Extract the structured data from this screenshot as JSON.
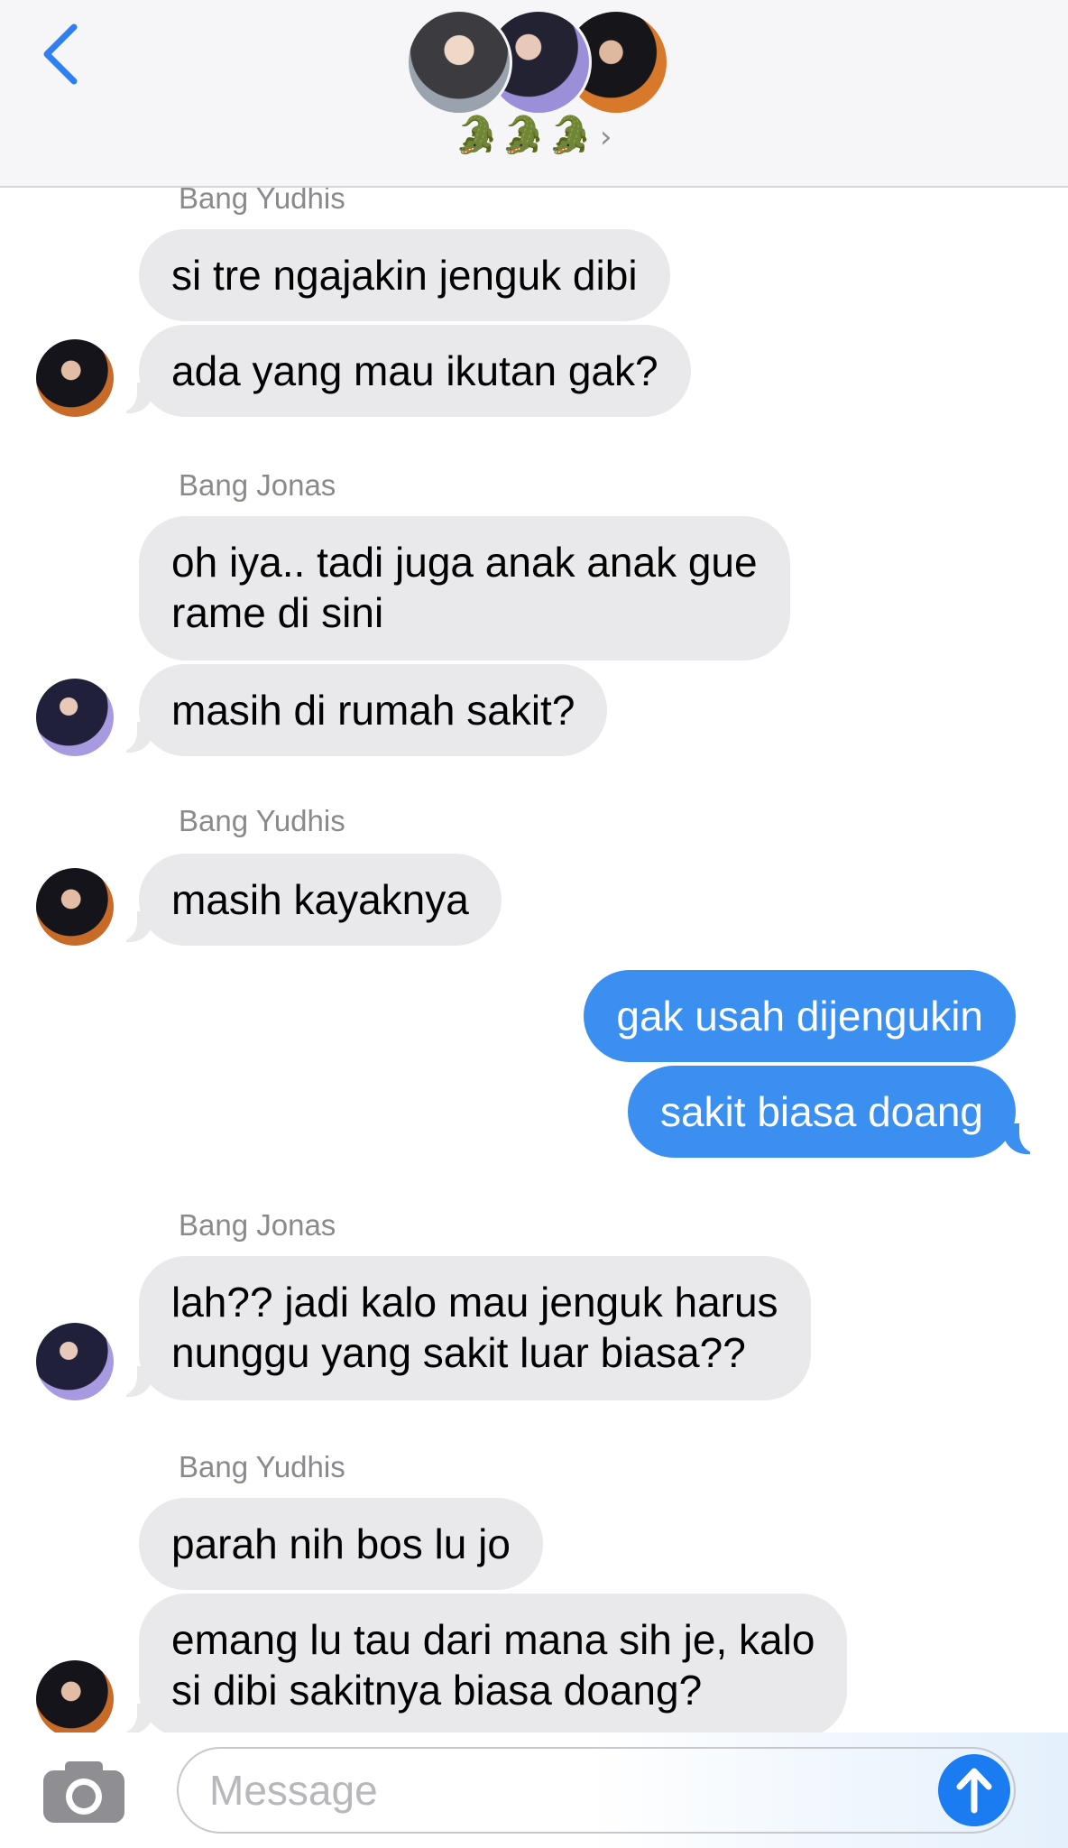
{
  "header": {
    "group_name": "🐊🐊🐊",
    "chevron": "›",
    "participants": [
      "avatar-1",
      "avatar-2",
      "avatar-3"
    ]
  },
  "messages": {
    "s1": "Bang Yudhis",
    "m1": "si tre ngajakin jenguk dibi",
    "m2": "ada yang mau ikutan gak?",
    "s2": "Bang Jonas",
    "m3": "oh iya.. tadi juga anak anak gue\nrame di sini",
    "m4": "masih di rumah sakit?",
    "s3": "Bang Yudhis",
    "m5": "masih kayaknya",
    "o1": "gak usah dijengukin",
    "o2": "sakit biasa doang",
    "s4": "Bang Jonas",
    "m6": "lah?? jadi kalo mau jenguk harus\nnunggu yang sakit luar biasa??",
    "s5": "Bang Yudhis",
    "m7": "parah nih bos lu jo",
    "m8": "emang lu tau dari mana sih je, kalo\nsi dibi sakitnya biasa doang?"
  },
  "composer": {
    "placeholder": "Message"
  },
  "colors": {
    "accent": "#1a7cf0",
    "outgoing_bubble": "#3b8ff0",
    "incoming_bubble": "#e9e9eb",
    "back_chevron": "#2f7ff0"
  }
}
